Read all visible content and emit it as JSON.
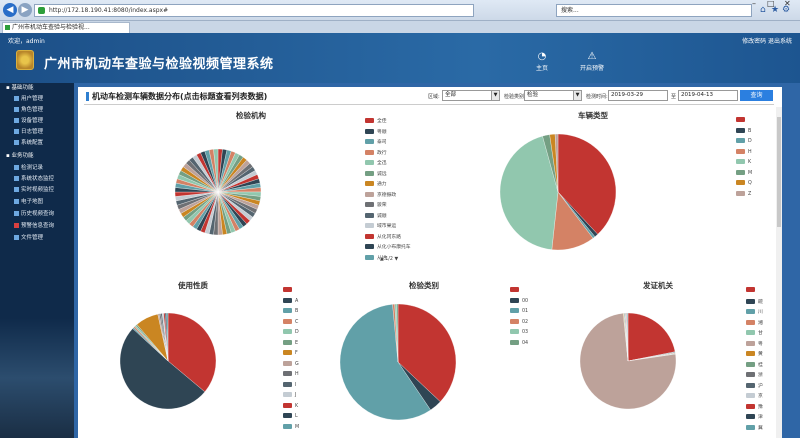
{
  "browser": {
    "url": "http://172.18.190.41:8080/index.aspx#",
    "search_placeholder": "搜索...",
    "tab_label": "广州市机动车查验与检验视..."
  },
  "header": {
    "welcome": "欢迎，admin",
    "top_links": "修改密码 退出系统",
    "title": "广州市机动车查验与检验视频管理系统",
    "nav": [
      {
        "label": "主页",
        "icon": "home-icon"
      },
      {
        "label": "开启预警",
        "icon": "warning-icon"
      }
    ]
  },
  "sidebar": {
    "groups": [
      {
        "label": "基础功能",
        "items": [
          "用户管理",
          "角色管理",
          "设备管理",
          "日志管理",
          "系统配置"
        ]
      },
      {
        "label": "业务功能",
        "items": [
          "检测记录",
          "系统状态监控",
          "实时视频监控",
          "电子地图",
          "历史视频查询",
          "预警信息查询",
          "文件管理"
        ]
      }
    ]
  },
  "panel": {
    "title": "机动车检测车辆数据分布(点击标题查看列表数据)",
    "filters": [
      {
        "label": "区域:",
        "value": "全部"
      },
      {
        "label": "检验类别:",
        "value": "检验"
      },
      {
        "label": "检测时间:",
        "value": "2019-03-29"
      },
      {
        "label": "至",
        "value": "2019-04-13"
      }
    ],
    "query_label": "查询"
  },
  "colors": {
    "accent": "#2b7fe0",
    "header": "#1c4f87",
    "sidebar": "#0f2a4a"
  },
  "chart_data": [
    {
      "type": "pie",
      "title": "检验机构",
      "note": "many equal slices",
      "legend": [
        "全佳",
        "粤顺",
        "泰司",
        "政行",
        "全迅",
        "诚远",
        "通力",
        "京德振政",
        "骏荣",
        "诚顺",
        "域市果运",
        "从化冈东路",
        "从化小布康托车",
        "从进"
      ],
      "legend_page": "1/2"
    },
    {
      "type": "pie",
      "title": "车辆类型",
      "series": [
        {
          "values": [
            {
              "name": "",
              "value": 38,
              "color": "#c23531"
            },
            {
              "name": "B",
              "value": 1,
              "color": "#2f4554"
            },
            {
              "name": "D",
              "value": 0.7,
              "color": "#61a0a8"
            },
            {
              "name": "H",
              "value": 12,
              "color": "#d48265"
            },
            {
              "name": "K",
              "value": 44,
              "color": "#91c7ae"
            },
            {
              "name": "M",
              "value": 2,
              "color": "#749f83"
            },
            {
              "name": "Q",
              "value": 1.5,
              "color": "#ca8622"
            },
            {
              "name": "Z",
              "value": 0.8,
              "color": "#bda29a"
            }
          ]
        }
      ]
    },
    {
      "type": "pie",
      "title": "使用性质",
      "series": [
        {
          "values": [
            {
              "name": "",
              "value": 37,
              "color": "#c23531"
            },
            {
              "name": "A",
              "value": 52,
              "color": "#2f4554"
            },
            {
              "name": "B",
              "value": 0.5,
              "color": "#61a0a8"
            },
            {
              "name": "C",
              "value": 0.5,
              "color": "#d48265"
            },
            {
              "name": "D",
              "value": 0.5,
              "color": "#91c7ae"
            },
            {
              "name": "E",
              "value": 0.5,
              "color": "#749f83"
            },
            {
              "name": "F",
              "value": 8,
              "color": "#ca8622"
            },
            {
              "name": "G",
              "value": 0.5,
              "color": "#bda29a"
            },
            {
              "name": "H",
              "value": 0.5,
              "color": "#6e7074"
            },
            {
              "name": "I",
              "value": 0.5,
              "color": "#546570"
            },
            {
              "name": "J",
              "value": 0.5,
              "color": "#c4ccd3"
            },
            {
              "name": "K",
              "value": 0.5,
              "color": "#c23531"
            },
            {
              "name": "L",
              "value": 0.5,
              "color": "#2f4554"
            },
            {
              "name": "M",
              "value": 0.5,
              "color": "#61a0a8"
            }
          ]
        }
      ]
    },
    {
      "type": "pie",
      "title": "检验类别",
      "series": [
        {
          "values": [
            {
              "name": "",
              "value": 37,
              "color": "#c23531"
            },
            {
              "name": "00",
              "value": 3.5,
              "color": "#2f4554"
            },
            {
              "name": "01",
              "value": 58,
              "color": "#61a0a8"
            },
            {
              "name": "02",
              "value": 0.6,
              "color": "#d48265"
            },
            {
              "name": "03",
              "value": 0.5,
              "color": "#91c7ae"
            },
            {
              "name": "04",
              "value": 0.4,
              "color": "#749f83"
            }
          ]
        }
      ]
    },
    {
      "type": "pie",
      "title": "发证机关",
      "series": [
        {
          "values": [
            {
              "name": "",
              "value": 22,
              "color": "#c23531"
            },
            {
              "name": "皖",
              "value": 0.2,
              "color": "#2f4554"
            },
            {
              "name": "川",
              "value": 0.2,
              "color": "#61a0a8"
            },
            {
              "name": "湘",
              "value": 0.2,
              "color": "#d48265"
            },
            {
              "name": "甘",
              "value": 0.2,
              "color": "#91c7ae"
            },
            {
              "name": "粤",
              "value": 76,
              "color": "#bda29a"
            },
            {
              "name": "黄",
              "value": 0.2,
              "color": "#ca8622"
            },
            {
              "name": "桂",
              "value": 0.2,
              "color": "#749f83"
            },
            {
              "name": "浙",
              "value": 0.2,
              "color": "#6e7074"
            },
            {
              "name": "沪",
              "value": 0.2,
              "color": "#546570"
            },
            {
              "name": "京",
              "value": 0.2,
              "color": "#c4ccd3"
            },
            {
              "name": "豫",
              "value": 0.2,
              "color": "#c23531"
            },
            {
              "name": "津",
              "value": 0.2,
              "color": "#2f4554"
            },
            {
              "name": "冀",
              "value": 0.2,
              "color": "#61a0a8"
            }
          ]
        }
      ]
    }
  ]
}
